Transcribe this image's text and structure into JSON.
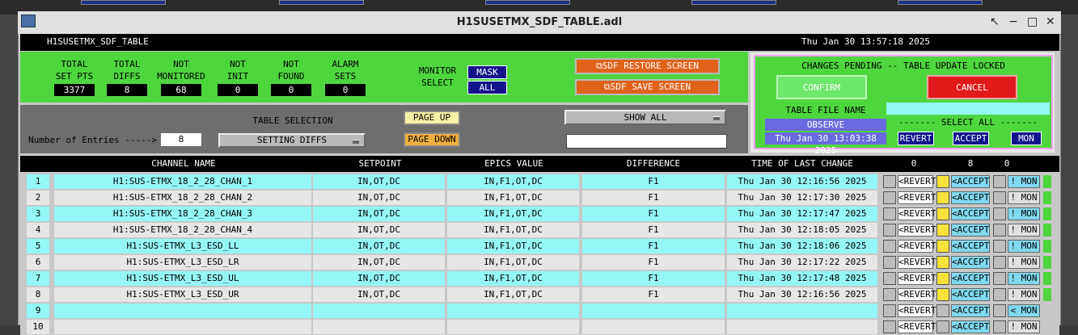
{
  "window": {
    "title": "H1SUSETMX_SDF_TABLE.adl"
  },
  "background": {
    "tile_label": "OBSERVE"
  },
  "header": {
    "name": "H1SUSETMX_SDF_TABLE",
    "datetime": "Thu Jan 30 13:57:18 2025"
  },
  "stats": [
    {
      "label1": "TOTAL",
      "label2": "SET PTS",
      "value": "3377"
    },
    {
      "label1": "TOTAL",
      "label2": "DIFFS",
      "value": "8"
    },
    {
      "label1": "NOT",
      "label2": "MONITORED",
      "value": "68"
    },
    {
      "label1": "NOT",
      "label2": "INIT",
      "value": "0"
    },
    {
      "label1": "NOT",
      "label2": "FOUND",
      "value": "0"
    },
    {
      "label1": "ALARM",
      "label2": "SETS",
      "value": "0"
    }
  ],
  "monitor": {
    "label1": "MONITOR",
    "label2": "SELECT",
    "mask": "MASK",
    "all": "ALL"
  },
  "restore_label": "SDF RESTORE SCREEN",
  "save_label": "SDF SAVE SCREEN",
  "pending": {
    "title": "CHANGES PENDING -- TABLE UPDATE LOCKED",
    "confirm": "CONFIRM",
    "cancel": "CANCEL",
    "file_name_label": "TABLE FILE NAME",
    "file_name": "OBSERVE",
    "file_time": "Thu Jan 30 13:03:38 2025",
    "select_all": "------- SELECT ALL -------",
    "revert": "REVERT",
    "accept": "ACCEPT",
    "mon": "MON"
  },
  "selection": {
    "entries_label": "Number of Entries ----->",
    "entries_value": "8",
    "table_selection_label": "TABLE SELECTION",
    "table_selection_value": "SETTING DIFFS",
    "page_up": "PAGE UP",
    "page_down": "PAGE DOWN",
    "show_all": "SHOW ALL",
    "search_value": ""
  },
  "table": {
    "columns": [
      "CHANNEL NAME",
      "SETPOINT",
      "EPICS VALUE",
      "DIFFERENCE",
      "TIME OF LAST CHANGE"
    ],
    "count_revert": "0",
    "count_accept": "8",
    "count_mon": "0",
    "rows": [
      {
        "num": "1",
        "channel": "H1:SUS-ETMX_18_2_28_CHAN_1",
        "setpoint": "IN,OT,DC",
        "epics": "IN,F1,OT,DC",
        "diff": "F1",
        "time": "Thu Jan 30 12:16:56 2025",
        "revert": "<REVERT",
        "accept": "<ACCEPT",
        "mon": "! MON"
      },
      {
        "num": "2",
        "channel": "H1:SUS-ETMX_18_2_28_CHAN_2",
        "setpoint": "IN,OT,DC",
        "epics": "IN,F1,OT,DC",
        "diff": "F1",
        "time": "Thu Jan 30 12:17:30 2025",
        "revert": "<REVERT",
        "accept": "<ACCEPT",
        "mon": "! MON"
      },
      {
        "num": "3",
        "channel": "H1:SUS-ETMX_18_2_28_CHAN_3",
        "setpoint": "IN,OT,DC",
        "epics": "IN,F1,OT,DC",
        "diff": "F1",
        "time": "Thu Jan 30 12:17:47 2025",
        "revert": "<REVERT",
        "accept": "<ACCEPT",
        "mon": "! MON"
      },
      {
        "num": "4",
        "channel": "H1:SUS-ETMX_18_2_28_CHAN_4",
        "setpoint": "IN,OT,DC",
        "epics": "IN,F1,OT,DC",
        "diff": "F1",
        "time": "Thu Jan 30 12:18:05 2025",
        "revert": "<REVERT",
        "accept": "<ACCEPT",
        "mon": "! MON"
      },
      {
        "num": "5",
        "channel": "H1:SUS-ETMX_L3_ESD_LL",
        "setpoint": "IN,OT,DC",
        "epics": "IN,F1,OT,DC",
        "diff": "F1",
        "time": "Thu Jan 30 12:18:06 2025",
        "revert": "<REVERT",
        "accept": "<ACCEPT",
        "mon": "! MON"
      },
      {
        "num": "6",
        "channel": "H1:SUS-ETMX_L3_ESD_LR",
        "setpoint": "IN,OT,DC",
        "epics": "IN,F1,OT,DC",
        "diff": "F1",
        "time": "Thu Jan 30 12:17:22 2025",
        "revert": "<REVERT",
        "accept": "<ACCEPT",
        "mon": "! MON"
      },
      {
        "num": "7",
        "channel": "H1:SUS-ETMX_L3_ESD_UL",
        "setpoint": "IN,OT,DC",
        "epics": "IN,F1,OT,DC",
        "diff": "F1",
        "time": "Thu Jan 30 12:17:48 2025",
        "revert": "<REVERT",
        "accept": "<ACCEPT",
        "mon": "! MON"
      },
      {
        "num": "8",
        "channel": "H1:SUS-ETMX_L3_ESD_UR",
        "setpoint": "IN,OT,DC",
        "epics": "IN,F1,OT,DC",
        "diff": "F1",
        "time": "Thu Jan 30 12:16:56 2025",
        "revert": "<REVERT",
        "accept": "<ACCEPT",
        "mon": "! MON"
      },
      {
        "num": "9",
        "channel": "",
        "setpoint": "",
        "epics": "",
        "diff": "",
        "time": "",
        "revert": "<REVERT",
        "accept": "<ACCEPT",
        "mon": "< MON"
      },
      {
        "num": "10",
        "channel": "",
        "setpoint": "",
        "epics": "",
        "diff": "",
        "time": "",
        "revert": "<REVERT",
        "accept": "<ACCEPT",
        "mon": "! MON"
      }
    ]
  },
  "colors": {
    "green": "#4fd63f",
    "cyan": "#95f6f6",
    "navy": "#13138c",
    "orange": "#e0621b",
    "red": "#e01a1a",
    "pink": "#f0a0f0"
  }
}
